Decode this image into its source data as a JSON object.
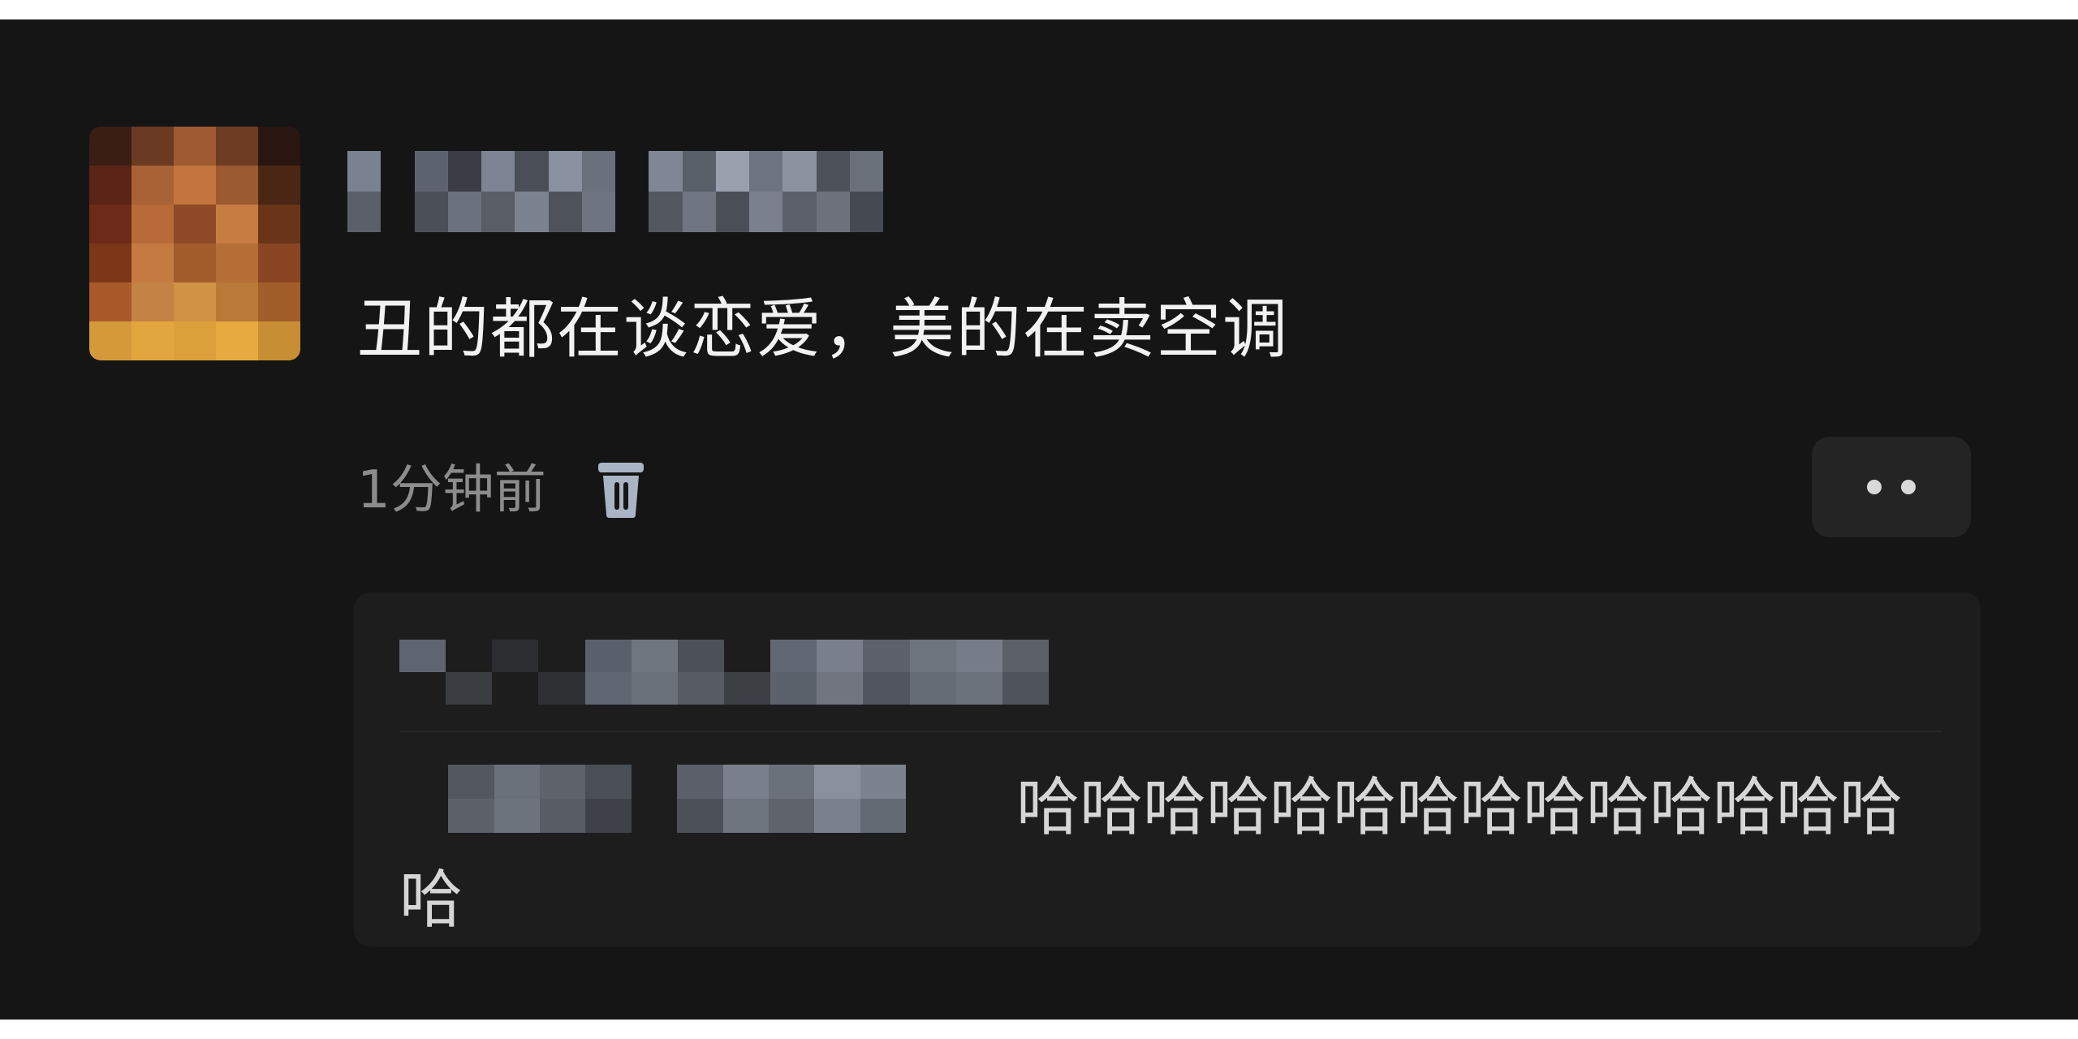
{
  "comment": {
    "text": "丑的都在谈恋爱，美的在卖空调",
    "time": "1分钟前",
    "delete_icon": "trash-icon",
    "more_icon": "more-dots-icon"
  },
  "reply": {
    "text": "哈哈哈哈哈哈哈哈哈哈哈哈哈哈哈"
  },
  "colors": {
    "background": "#151515",
    "reply_background": "#1d1d1d",
    "primary_text": "#f2f2f2",
    "secondary_text": "#8c8c8c",
    "icon": "#a9b4c4"
  }
}
